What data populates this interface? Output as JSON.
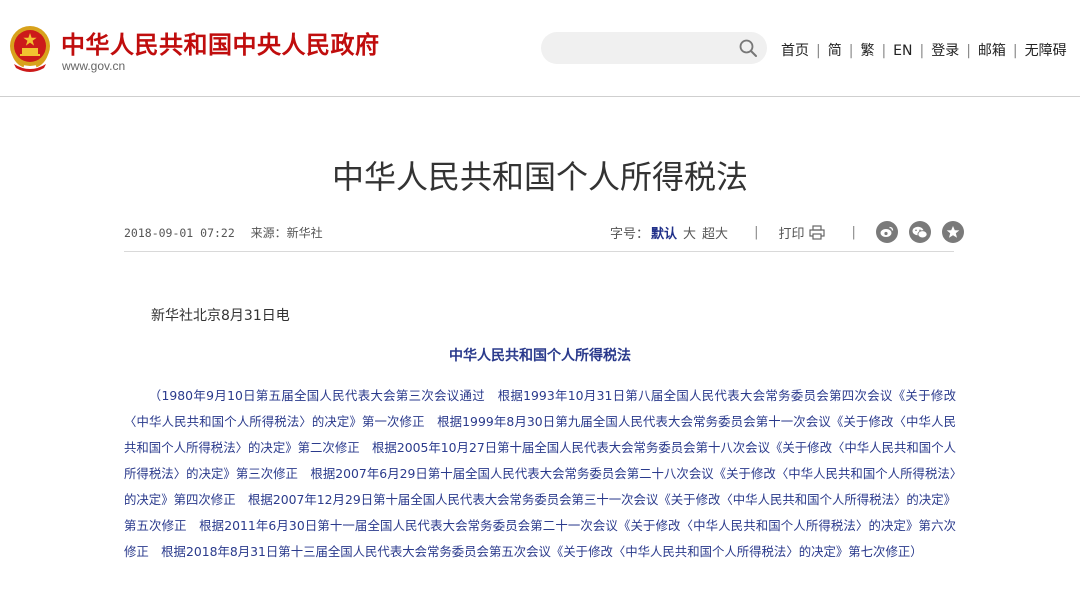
{
  "header": {
    "site_title": "中华人民共和国中央人民政府",
    "site_url": "www.gov.cn",
    "emblem_icon": "national-emblem-icon",
    "search": {
      "value": "",
      "icon": "search-icon"
    },
    "nav": {
      "home": "首页",
      "simplified": "简",
      "traditional": "繁",
      "english": "EN",
      "login": "登录",
      "mail": "邮箱",
      "accessibility": "无障碍"
    }
  },
  "article": {
    "title": "中华人民共和国个人所得税法",
    "datetime": "2018-09-01 07:22",
    "source_label": "来源：",
    "source": "新华社",
    "font_size_label": "字号：",
    "font_sizes": {
      "default": "默认",
      "large": "大",
      "xlarge": "超大"
    },
    "print_label": "打印",
    "share_icons": [
      "weibo-icon",
      "wechat-icon",
      "favorite-icon"
    ],
    "dateline": "新华社北京8月31日电",
    "law_name": "中华人民共和国个人所得税法",
    "history": "（1980年9月10日第五届全国人民代表大会第三次会议通过　根据1993年10月31日第八届全国人民代表大会常务委员会第四次会议《关于修改〈中华人民共和国个人所得税法〉的决定》第一次修正　根据1999年8月30日第九届全国人民代表大会常务委员会第十一次会议《关于修改〈中华人民共和国个人所得税法〉的决定》第二次修正　根据2005年10月27日第十届全国人民代表大会常务委员会第十八次会议《关于修改〈中华人民共和国个人所得税法〉的决定》第三次修正　根据2007年6月29日第十届全国人民代表大会常务委员会第二十八次会议《关于修改〈中华人民共和国个人所得税法〉的决定》第四次修正　根据2007年12月29日第十届全国人民代表大会常务委员会第三十一次会议《关于修改〈中华人民共和国个人所得税法〉的决定》第五次修正　根据2011年6月30日第十一届全国人民代表大会常务委员会第二十一次会议《关于修改〈中华人民共和国个人所得税法〉的决定》第六次修正　根据2018年8月31日第十三届全国人民代表大会常务委员会第五次会议《关于修改〈中华人民共和国个人所得税法〉的决定》第七次修正）"
  },
  "colors": {
    "brand_red": "#c00d0d",
    "law_blue": "#2a3a8c",
    "active_font_size": "#21318a"
  }
}
